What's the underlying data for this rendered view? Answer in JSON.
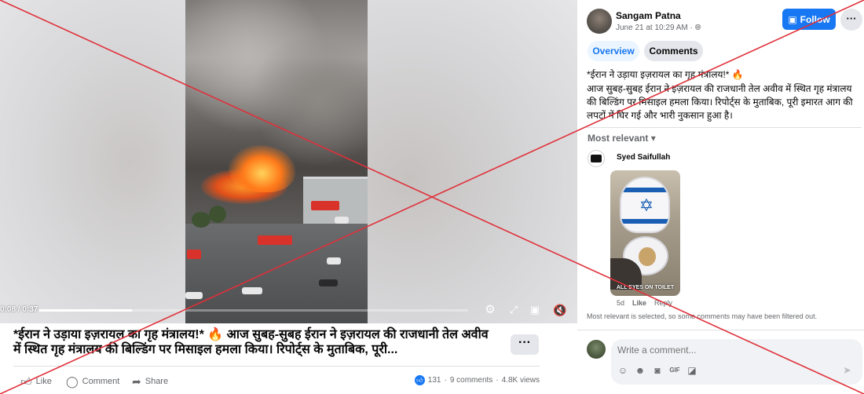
{
  "video": {
    "time": "0:08 / 0:37",
    "progress": 0.216
  },
  "caption": {
    "text": "*ईरान ने उड़ाया इज़रायल का गृह मंत्रालय!* 🔥 आज सुबह-सुबह ईरान ने इज़रायल की राजधानी तेल अवीव में स्थित गृह मंत्रालय की बिल्डिंग पर मिसाइल हमला किया। रिपोर्ट्स के मुताबिक, पूरी...",
    "more_label": "···"
  },
  "actions": {
    "like": "Like",
    "comment": "Comment",
    "share": "Share"
  },
  "stats": {
    "reactions": "131",
    "comments": "9 comments",
    "views": "4.8K views",
    "sep": "·"
  },
  "post": {
    "author": "Sangam Patna",
    "date": "June 21 at 10:29 AM · ",
    "follow": "Follow",
    "more": "···",
    "tabs": [
      "Overview",
      "Comments"
    ],
    "title": "*ईरान ने उड़ाया इज़रायल का गृह मंत्रालय!* 🔥",
    "body": "आज सुबह-सुबह ईरान ने इज़रायल की राजधानी तेल अवीव में स्थित गृह मंत्रालय की बिल्डिंग पर मिसाइल हमला किया। रिपोर्ट्स के मुताबिक, पूरी इमारत आग की लपटों में घिर गई और भारी नुकसान हुआ है।"
  },
  "comments": {
    "sort": "Most relevant ▾",
    "items": [
      {
        "author": "Syed Saifullah",
        "image_caption": "ALL EYES ON TOILET",
        "time": "5d",
        "like": "Like",
        "reply": "Reply"
      }
    ],
    "filter_note": "Most relevant is selected, so some comments may have been filtered out.",
    "placeholder": "Write a comment..."
  },
  "colors": {
    "accent": "#1877f2",
    "overlay_cross": "#e0303a"
  }
}
